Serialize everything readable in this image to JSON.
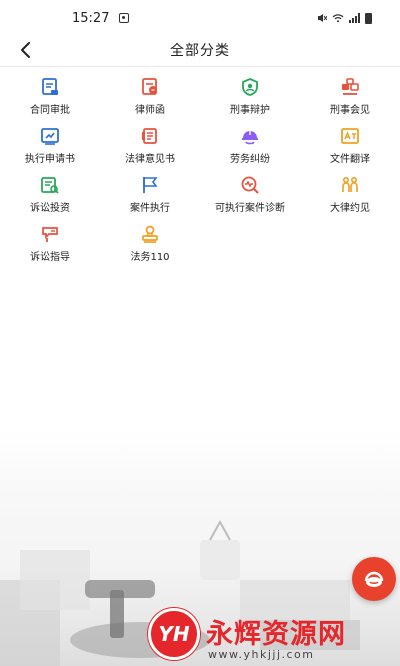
{
  "status_bar": {
    "time": "15:27"
  },
  "header": {
    "back_icon": "chevron-left-icon",
    "title": "全部分类"
  },
  "categories": [
    {
      "label": "合同审批",
      "icon": "contract-approval-icon",
      "color": "#2e6fd6"
    },
    {
      "label": "律师函",
      "icon": "lawyer-letter-icon",
      "color": "#e8523f"
    },
    {
      "label": "刑事辩护",
      "icon": "shield-icon",
      "color": "#27a85a"
    },
    {
      "label": "刑事会见",
      "icon": "meeting-icon",
      "color": "#e8523f"
    },
    {
      "label": "执行申请书",
      "icon": "application-icon",
      "color": "#2e6fd6"
    },
    {
      "label": "法律意见书",
      "icon": "legal-opinion-icon",
      "color": "#e8523f"
    },
    {
      "label": "劳务纠纷",
      "icon": "worker-helmet-icon",
      "color": "#8b5cf6"
    },
    {
      "label": "文件翻译",
      "icon": "translate-icon",
      "color": "#f0a020"
    },
    {
      "label": "诉讼投资",
      "icon": "litigation-investment-icon",
      "color": "#27a85a"
    },
    {
      "label": "案件执行",
      "icon": "flag-icon",
      "color": "#2e6fd6"
    },
    {
      "label": "可执行案件诊断",
      "icon": "diagnosis-icon",
      "color": "#e8523f"
    },
    {
      "label": "大律约见",
      "icon": "appointment-icon",
      "color": "#f0a020"
    },
    {
      "label": "诉讼指导",
      "icon": "guidance-icon",
      "color": "#e8523f"
    },
    {
      "label": "法务110",
      "icon": "legal-110-icon",
      "color": "#f0a020"
    }
  ],
  "floating_button": {
    "icon": "customer-service-icon",
    "color": "#e8422c"
  },
  "watermark": {
    "logo_text": "YH",
    "title": "永辉资源网",
    "url": "www.yhkjjj.com",
    "color": "#e5262b"
  }
}
